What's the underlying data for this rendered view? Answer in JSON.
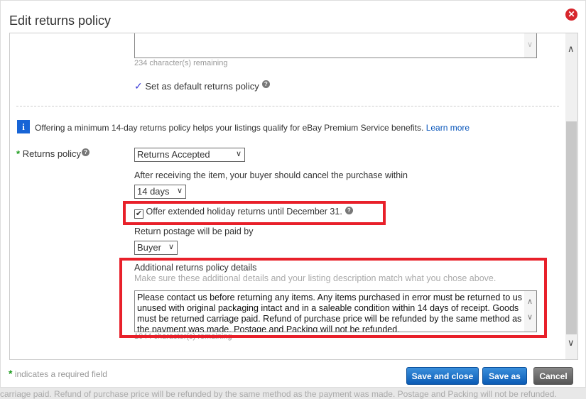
{
  "background_text": "carriage paid. Refund of purchase price will be refunded by the same method as the payment was made. Postage and Packing will not be refunded.",
  "dialog": {
    "title": "Edit returns policy",
    "close_icon": "close-icon"
  },
  "form": {
    "top_remaining": "234 character(s) remaining",
    "default_policy_label": "Set as default returns policy",
    "default_policy_checked": true,
    "info_text": "Offering a minimum 14-day returns policy helps your listings qualify for eBay Premium Service benefits.",
    "info_link": "Learn more",
    "returns_policy_label": "Returns policy",
    "returns_policy_value": "Returns Accepted",
    "cancel_within_label": "After receiving the item, your buyer should cancel the purchase within",
    "cancel_within_value": "14 days",
    "holiday_label": "Offer extended holiday returns until December 31.",
    "holiday_checked": true,
    "postage_label": "Return postage will be paid by",
    "postage_value": "Buyer",
    "details_label": "Additional returns policy details",
    "details_hint": "Make sure these additional details and your listing description match what you chose above.",
    "details_value": "Please contact us before returning any items. Any items purchased in error must be returned to us unused with original packaging intact and in a saleable condition within 14 days of receipt. Goods must be returned carriage paid. Refund of purchase price will be refunded by the same method as the payment was made. Postage and Packing will not be refunded.",
    "details_remaining": "1044 character(s) remaining"
  },
  "footer": {
    "required_note": "indicates a required field",
    "save_close": "Save and close",
    "save_as": "Save as",
    "cancel": "Cancel"
  },
  "colors": {
    "highlight": "#e8202a",
    "primary_button": "#0b5bb5",
    "required": "#1a9a1a"
  }
}
